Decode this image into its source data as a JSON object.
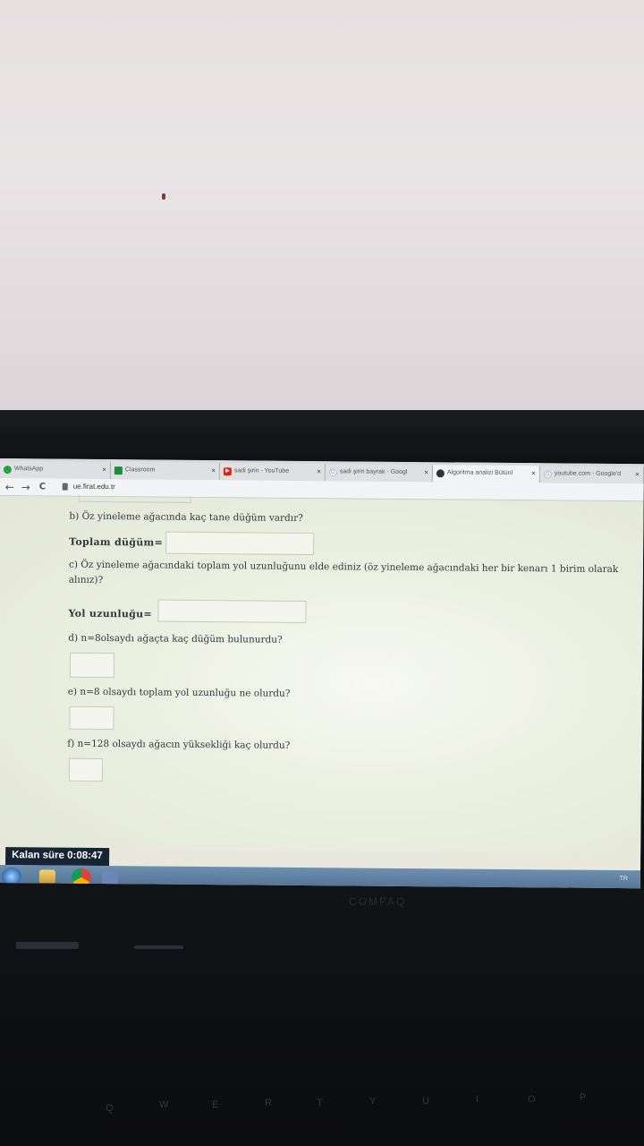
{
  "browser": {
    "tabs": [
      {
        "label": "WhatsApp",
        "icon": "whatsapp-icon",
        "color": "#25a244"
      },
      {
        "label": "Classroom",
        "icon": "classroom-icon",
        "color": "#1e8e3e"
      },
      {
        "label": "sadi şirin - YouTube",
        "icon": "youtube-icon",
        "color": "#e62117"
      },
      {
        "label": "sadi şirin bayrak - Googl",
        "icon": "google-icon",
        "color": "#4285f4"
      },
      {
        "label": "Algoritma analizi Bütünl",
        "icon": "site-icon",
        "color": "#333333"
      },
      {
        "label": "youtube.com - Google'd",
        "icon": "google-icon",
        "color": "#4285f4"
      }
    ],
    "close_glyph": "×",
    "back_glyph": "←",
    "forward_glyph": "→",
    "reload_glyph": "C",
    "url": "ue.firat.edu.tr"
  },
  "quiz": {
    "q_b": "b) Öz yineleme ağacında kaç tane düğüm vardır?",
    "label_b": "Toplam düğüm=",
    "q_c": "c) Öz yineleme ağacındaki toplam yol uzunluğunu elde ediniz (öz yineleme ağacındaki her bir kenarı 1 birim olarak alınız)?",
    "label_c": "Yol uzunluğu=",
    "q_d": "d) n=8olsaydı ağaçta kaç düğüm bulunurdu?",
    "q_e": "e) n=8 olsaydı toplam yol uzunluğu ne olurdu?",
    "q_f": "f) n=128 olsaydı ağacın yüksekliği kaç olurdu?"
  },
  "timer": {
    "label": "Kalan süre 0:08:47"
  },
  "taskbar": {
    "items": [
      "start-button",
      "explorer-icon",
      "chrome-icon",
      "app-icon"
    ],
    "tray": "TR"
  },
  "hardware": {
    "brand": "COMPAQ"
  },
  "keyboard": {
    "keys": [
      "Q",
      "W",
      "E",
      "R",
      "T",
      "Y",
      "U",
      "I",
      "O",
      "P"
    ]
  },
  "colors": {
    "timer_bg": "#162433",
    "page_bg": "#ecf0e0",
    "taskbar": "#5b7ea1"
  }
}
